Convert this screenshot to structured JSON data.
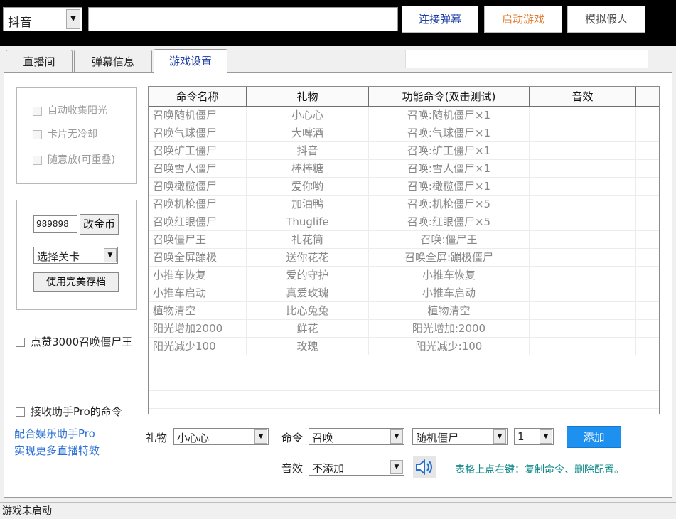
{
  "topbar": {
    "platform_value": "抖音",
    "room_input_value": "",
    "connect_label": "连接弹幕",
    "start_game_label": "启动游戏",
    "simulate_label": "模拟假人",
    "colors": {
      "connect": "#1f3fa8",
      "start_game": "#e07a2f",
      "simulate": "#555555"
    }
  },
  "tabs": [
    {
      "label": "直播间"
    },
    {
      "label": "弹幕信息"
    },
    {
      "label": "游戏设置"
    }
  ],
  "left": {
    "options": [
      {
        "label": "自动收集阳光"
      },
      {
        "label": "卡片无冷却"
      },
      {
        "label": "随意放(可重叠)"
      }
    ],
    "gold_value": "989898",
    "gold_button": "改金币",
    "level_select": "选择关卡",
    "save_button": "使用完美存档",
    "like_option": "点赞3000召唤僵尸王",
    "receive_option": "接收助手Pro的命令",
    "link_line1": "配合娱乐助手Pro",
    "link_line2": "实现更多直播特效"
  },
  "table": {
    "headers": [
      "命令名称",
      "礼物",
      "功能命令(双击测试)",
      "音效"
    ],
    "rows": [
      [
        "召唤随机僵尸",
        "小心心",
        "召唤:随机僵尸×1",
        ""
      ],
      [
        "召唤气球僵尸",
        "大啤酒",
        "召唤:气球僵尸×1",
        ""
      ],
      [
        "召唤矿工僵尸",
        "抖音",
        "召唤:矿工僵尸×1",
        ""
      ],
      [
        "召唤雪人僵尸",
        "棒棒糖",
        "召唤:雪人僵尸×1",
        ""
      ],
      [
        "召唤橄榄僵尸",
        "爱你哟",
        "召唤:橄榄僵尸×1",
        ""
      ],
      [
        "召唤机枪僵尸",
        "加油鸭",
        "召唤:机枪僵尸×5",
        ""
      ],
      [
        "召唤红眼僵尸",
        "Thuglife",
        "召唤:红眼僵尸×5",
        ""
      ],
      [
        "召唤僵尸王",
        "礼花筒",
        "召唤:僵尸王",
        ""
      ],
      [
        "召唤全屏蹦极",
        "送你花花",
        "召唤全屏:蹦极僵尸",
        ""
      ],
      [
        "小推车恢复",
        "爱的守护",
        "小推车恢复",
        ""
      ],
      [
        "小推车启动",
        "真爱玫瑰",
        "小推车启动",
        ""
      ],
      [
        "植物清空",
        "比心兔兔",
        "植物清空",
        ""
      ],
      [
        "阳光增加2000",
        "鲜花",
        "阳光增加:2000",
        ""
      ],
      [
        "阳光减少100",
        "玫瑰",
        "阳光减少:100",
        ""
      ]
    ]
  },
  "form": {
    "gift_label": "礼物",
    "gift_value": "小心心",
    "command_label": "命令",
    "command_value": "召唤",
    "target_value": "随机僵尸",
    "count_value": "1",
    "add_button": "添加",
    "sound_label": "音效",
    "sound_value": "不添加",
    "speaker_icon": "speaker-icon",
    "hint": "表格上点右键：复制命令、删除配置。"
  },
  "status": {
    "text": "游戏未启动"
  }
}
